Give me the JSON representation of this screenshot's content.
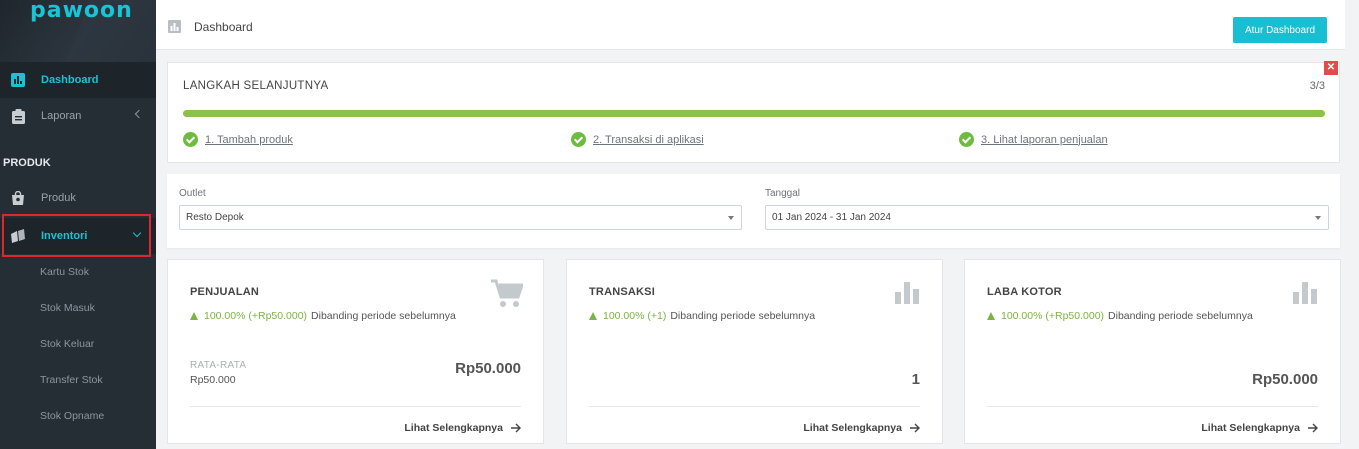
{
  "brand": {
    "logo": "pawoon"
  },
  "sidebar": {
    "items": [
      {
        "label": "Dashboard",
        "icon": "bar-chart-icon",
        "active": true
      },
      {
        "label": "Laporan",
        "icon": "clipboard-icon"
      }
    ],
    "section_heading": "PRODUK",
    "produk_items": [
      {
        "label": "Produk",
        "icon": "shopping-bag-icon"
      },
      {
        "label": "Inventori",
        "icon": "boxes-icon",
        "active": true
      }
    ],
    "inventori_sub": [
      "Kartu Stok",
      "Stok Masuk",
      "Stok Keluar",
      "Transfer Stok",
      "Stok Opname"
    ]
  },
  "topbar": {
    "title": "Dashboard",
    "button": "Atur Dashboard"
  },
  "steps": {
    "heading": "LANGKAH SELANJUTNYA",
    "count": "3/3",
    "progress": 1.0,
    "items": [
      "1. Tambah produk",
      "2. Transaksi di aplikasi",
      "3. Lihat laporan penjualan"
    ],
    "close": "✕"
  },
  "filters": {
    "outlet_label": "Outlet",
    "outlet_value": "Resto Depok",
    "date_label": "Tanggal",
    "date_value": "01 Jan 2024 - 31 Jan 2024"
  },
  "stats": [
    {
      "title": "PENJUALAN",
      "pct": "100.00% (+Rp50.000)",
      "cmp": "Dibanding periode sebelumnya",
      "avg_label": "RATA-RATA",
      "avg_value": "Rp50.000",
      "value": "Rp50.000",
      "more": "Lihat Selengkapnya",
      "icon": "cart-icon"
    },
    {
      "title": "TRANSAKSI",
      "pct": "100.00% (+1)",
      "cmp": "Dibanding periode sebelumnya",
      "value": "1",
      "more": "Lihat Selengkapnya",
      "icon": "bar-chart-icon"
    },
    {
      "title": "LABA KOTOR",
      "pct": "100.00% (+Rp50.000)",
      "cmp": "Dibanding periode sebelumnya",
      "value": "Rp50.000",
      "more": "Lihat Selengkapnya",
      "icon": "bar-chart-icon"
    }
  ],
  "colors": {
    "accent": "#18bfd1",
    "success": "#7cb342",
    "sidebar": "#252d35",
    "highlight": "#e0262d"
  }
}
